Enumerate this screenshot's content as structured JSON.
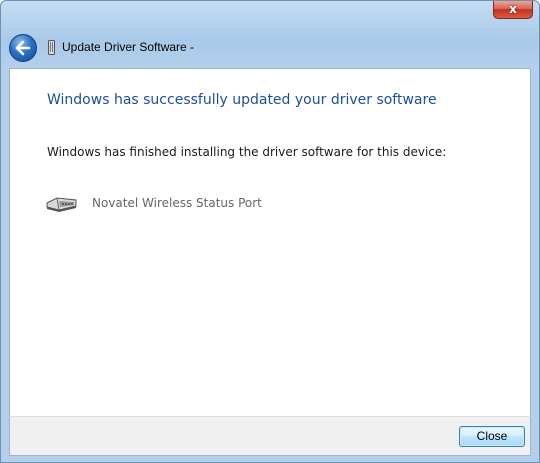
{
  "window": {
    "title": "Update Driver Software -",
    "close_glyph": "x"
  },
  "content": {
    "heading": "Windows has successfully updated your driver software",
    "message": "Windows has finished installing the driver software for this device:",
    "device": {
      "name": "Novatel Wireless Status Port",
      "icon": "port-connector-icon"
    }
  },
  "footer": {
    "close_label": "Close"
  },
  "colors": {
    "heading": "#1c4fa0",
    "device_text": "#666666",
    "titlebar_close": "#c2321f"
  }
}
